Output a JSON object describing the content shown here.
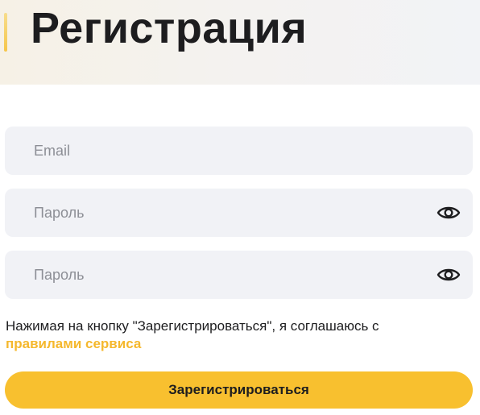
{
  "header": {
    "title": "Регистрация"
  },
  "form": {
    "email": {
      "placeholder": "Email",
      "value": ""
    },
    "password": {
      "placeholder": "Пароль",
      "value": "",
      "toggle_icon": "eye-icon"
    },
    "password_confirm": {
      "placeholder": "Пароль",
      "value": "",
      "toggle_icon": "eye-icon"
    }
  },
  "consent": {
    "text": "Нажимая на кнопку \"Зарегистрироваться\", я соглашаюсь с ",
    "link_label": "правилами сервиса"
  },
  "submit": {
    "label": "Зарегистрироваться"
  },
  "colors": {
    "accent": "#f8c02f",
    "link": "#f5b82d",
    "field_bg": "#f1f2f6",
    "text": "#1d1d1f",
    "placeholder": "#8d8f96"
  }
}
